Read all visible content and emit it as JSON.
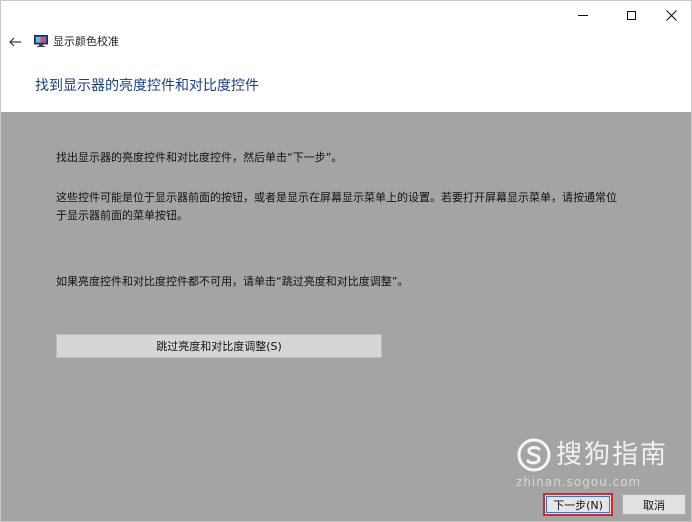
{
  "window": {
    "app_title": "显示颜色校准",
    "controls": {
      "minimize_icon": "minimize-icon",
      "maximize_icon": "maximize-icon",
      "close_icon": "close-icon"
    }
  },
  "nav": {
    "back_icon": "back-arrow-icon",
    "app_icon": "monitor-icon"
  },
  "heading": "找到显示器的亮度控件和对比度控件",
  "content": {
    "paragraph_1": "找出显示器的亮度控件和对比度控件，然后单击“下一步”。",
    "paragraph_2": "这些控件可能是位于显示器前面的按钮，或者是显示在屏幕显示菜单上的设置。若要打开屏幕显示菜单，请按通常位于显示器前面的菜单按钮。",
    "paragraph_3": "如果亮度控件和对比度控件都不可用，请单击“跳过亮度和对比度调整”。",
    "skip_button_label": "跳过亮度和对比度调整(S)"
  },
  "footer": {
    "next_button_label": "下一步(N)",
    "cancel_button_label": "取消"
  },
  "watermark": {
    "text": "搜狗指南",
    "url": "zhinan.sogou.com"
  },
  "colors": {
    "heading": "#1a3d8f",
    "content_bg": "#a4a4a4",
    "highlight_border": "#d9262b",
    "focus_border": "#2c78d6"
  }
}
